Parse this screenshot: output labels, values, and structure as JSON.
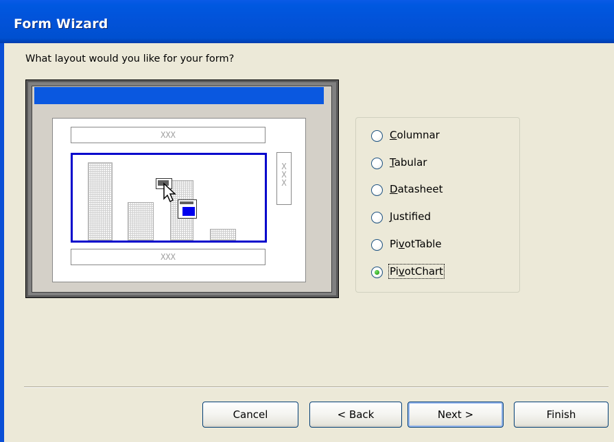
{
  "window": {
    "title": "Form Wizard"
  },
  "question": "What layout would you like for your form?",
  "preview": {
    "placeholder_text": "XXX",
    "side_text": "X\nX\nX"
  },
  "layout_options": [
    {
      "label": "Columnar",
      "underline": "C",
      "selected": false
    },
    {
      "label": "Tabular",
      "underline": "T",
      "selected": false
    },
    {
      "label": "Datasheet",
      "underline": "D",
      "selected": false
    },
    {
      "label": "Justified",
      "underline": "J",
      "selected": false
    },
    {
      "label": "PivotTable",
      "underline": "v",
      "selected": false
    },
    {
      "label": "PivotChart",
      "underline": "v",
      "selected": true
    }
  ],
  "buttons": {
    "cancel": "Cancel",
    "back": "< Back",
    "next": "Next >",
    "finish": "Finish"
  },
  "colors": {
    "title_bar": "#0054e3",
    "dialog_bg": "#ece9d8",
    "chart_border": "#0000cc",
    "radio_selected": "#2fa51e"
  }
}
